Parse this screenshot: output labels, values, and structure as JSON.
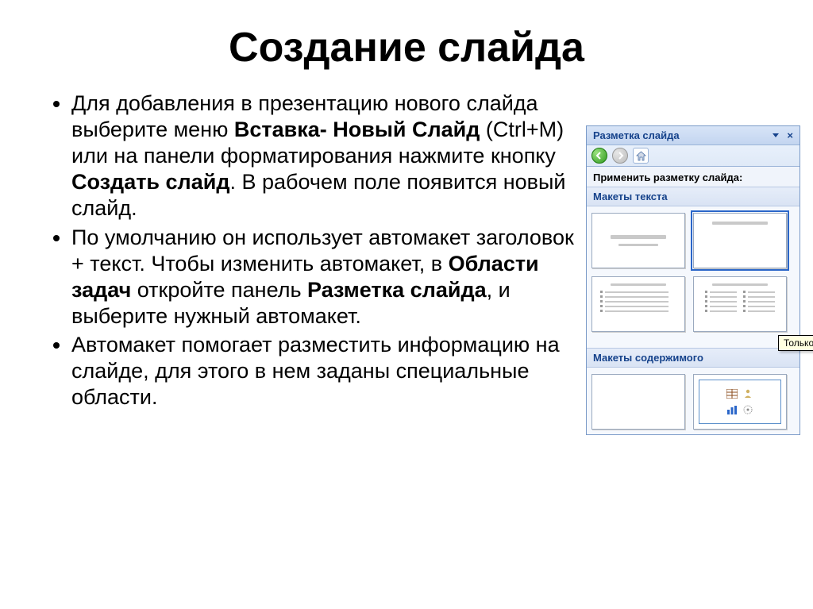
{
  "title": "Создание слайда",
  "bullets": [
    {
      "pre": "Для добавления в презентацию нового слайда выберите меню ",
      "b1": "Вставка- Новый Слайд",
      "mid1": " (Ctrl+M) или на панели форматирования нажмите кнопку ",
      "b2": "Создать слайд",
      "post": ". В рабочем поле появится новый слайд."
    },
    {
      "pre": "По умолчанию он использует автомакет заголовок + текст. Чтобы изменить автомакет, в ",
      "b1": "Области задач",
      "mid1": " откройте панель ",
      "b2": "Разметка слайда",
      "post": ", и выберите нужный автомакет."
    },
    {
      "pre": "Автомакет помогает разместить информацию на слайде, для этого в нем заданы специальные области.",
      "b1": "",
      "mid1": "",
      "b2": "",
      "post": ""
    }
  ],
  "pane": {
    "title": "Разметка слайда",
    "apply_label": "Применить разметку слайда:",
    "section_text": "Макеты текста",
    "section_content": "Макеты содержимого",
    "tooltip": "Только заголо"
  }
}
